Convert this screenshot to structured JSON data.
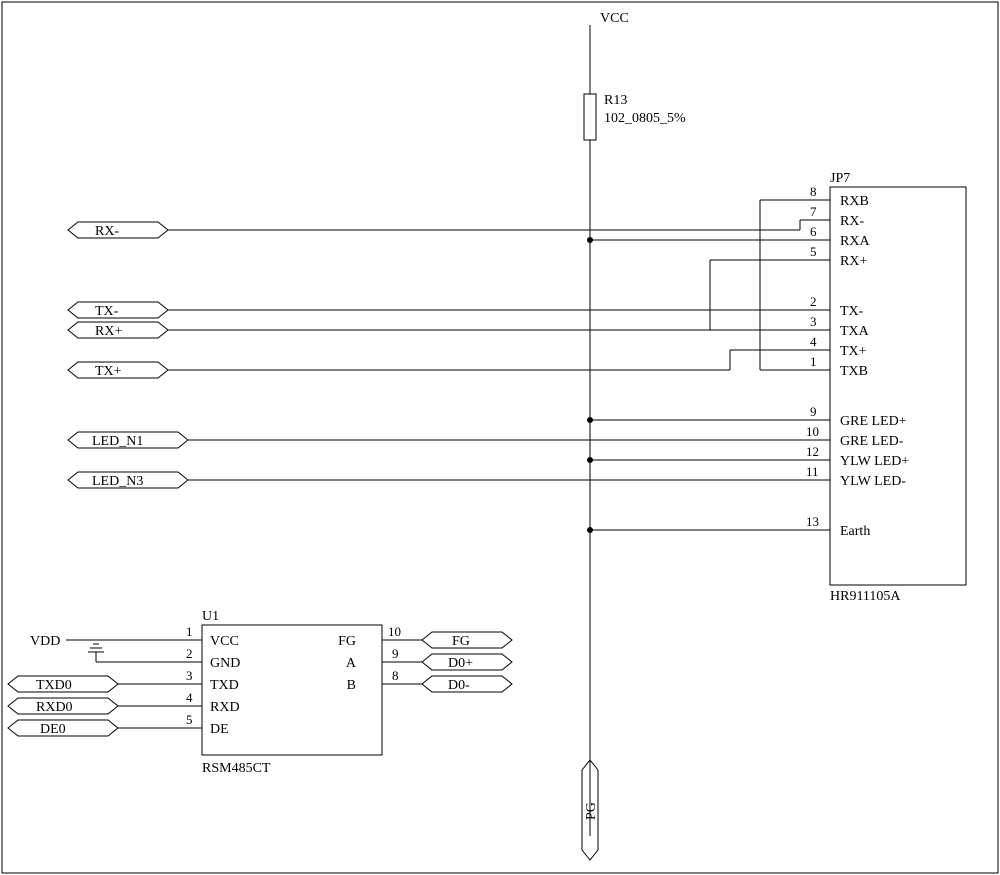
{
  "power": {
    "vcc_label": "VCC"
  },
  "r13": {
    "ref": "R13",
    "value": "102_0805_5%"
  },
  "jp7": {
    "ref": "JP7",
    "part": "HR911105A",
    "pins": {
      "p8": {
        "num": "8",
        "name": "RXB"
      },
      "p7": {
        "num": "7",
        "name": "RX-"
      },
      "p6": {
        "num": "6",
        "name": "RXA"
      },
      "p5": {
        "num": "5",
        "name": "RX+"
      },
      "p2": {
        "num": "2",
        "name": "TX-"
      },
      "p3": {
        "num": "3",
        "name": "TXA"
      },
      "p4": {
        "num": "4",
        "name": "TX+"
      },
      "p1": {
        "num": "1",
        "name": "TXB"
      },
      "p9": {
        "num": "9",
        "name": "GRE LED+"
      },
      "p10": {
        "num": "10",
        "name": "GRE LED-"
      },
      "p12": {
        "num": "12",
        "name": "YLW LED+"
      },
      "p11": {
        "num": "11",
        "name": "YLW LED-"
      },
      "p13": {
        "num": "13",
        "name": "Earth"
      }
    }
  },
  "u1": {
    "ref": "U1",
    "part": "RSM485CT",
    "pins": {
      "p1": {
        "num": "1",
        "name": "VCC"
      },
      "p2": {
        "num": "2",
        "name": "GND"
      },
      "p3": {
        "num": "3",
        "name": "TXD"
      },
      "p4": {
        "num": "4",
        "name": "RXD"
      },
      "p5": {
        "num": "5",
        "name": "DE"
      },
      "p10": {
        "num": "10",
        "name": "FG"
      },
      "p9": {
        "num": "9",
        "name": "A"
      },
      "p8": {
        "num": "8",
        "name": "B"
      }
    }
  },
  "nets": {
    "rx_minus": "RX-",
    "tx_minus": "TX-",
    "rx_plus": "RX+",
    "tx_plus": "TX+",
    "led_n1": "LED_N1",
    "led_n3": "LED_N3",
    "vdd": "VDD",
    "txd0": "TXD0",
    "rxd0": "RXD0",
    "de0": "DE0",
    "fg": "FG",
    "d0_plus": "D0+",
    "d0_minus": "D0-",
    "pg": "PG"
  }
}
